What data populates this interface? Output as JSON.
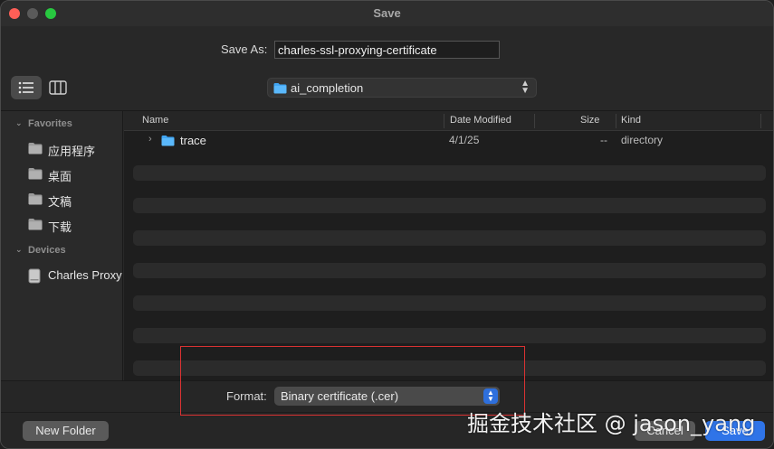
{
  "window": {
    "title": "Save"
  },
  "save_as": {
    "label": "Save As:",
    "value": "charles-ssl-proxying-certificate"
  },
  "toolbar": {
    "view_list_icon": "list-view-icon",
    "view_column_icon": "column-view-icon",
    "location": "ai_completion"
  },
  "sidebar": {
    "favorites_header": "Favorites",
    "favorites": [
      {
        "label": "应用程序",
        "icon": "folder-icon"
      },
      {
        "label": "桌面",
        "icon": "folder-icon"
      },
      {
        "label": "文稿",
        "icon": "folder-icon"
      },
      {
        "label": "下载",
        "icon": "folder-icon"
      }
    ],
    "devices_header": "Devices",
    "devices": [
      {
        "label": "Charles Proxy",
        "icon": "disk-icon"
      }
    ]
  },
  "file_list": {
    "columns": [
      "Name",
      "Date Modified",
      "Size",
      "Kind"
    ],
    "rows": [
      {
        "name": "trace",
        "date": "4/1/25",
        "size": "--",
        "kind": "directory"
      }
    ]
  },
  "format": {
    "label": "Format:",
    "value": "Binary certificate (.cer)"
  },
  "buttons": {
    "new_folder": "New Folder",
    "cancel": "Cancel",
    "save": "Save"
  },
  "watermark": "掘金技术社区 @ jason_yang",
  "colors": {
    "accent": "#2f74e8",
    "highlight_box": "#d93232"
  }
}
